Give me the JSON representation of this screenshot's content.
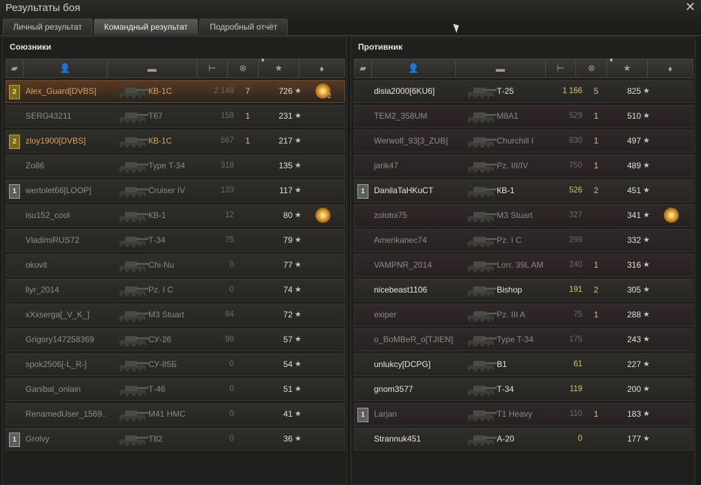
{
  "window": {
    "title": "Результаты боя",
    "close_label": "✕"
  },
  "tabs": [
    {
      "label": "Личный результат",
      "active": false
    },
    {
      "label": "Командный результат",
      "active": true
    },
    {
      "label": "Подробный отчёт",
      "active": false
    }
  ],
  "columns": [
    "squad-icon",
    "player-icon",
    "tank-icon",
    "damage-icon",
    "kills-icon",
    "xp-star-icon",
    "medal-icon"
  ],
  "header_glyphs": {
    "squad": "▰",
    "player": "👤",
    "tank": "▬",
    "damage": "⊢",
    "kills": "⊗",
    "star": "★",
    "medal": "♦"
  },
  "allies": {
    "title": "Союзники",
    "rows": [
      {
        "squad": "2",
        "squad_type": "gold",
        "player": "Alex_Guard[DVBS]",
        "vehicle": "КВ-1С",
        "damage": "2 148",
        "frags": "7",
        "xp": "726",
        "medal": true,
        "medal_count": "2",
        "style": "hl"
      },
      {
        "squad": "",
        "player": "SERG43211",
        "vehicle": "T67",
        "damage": "158",
        "frags": "1",
        "xp": "231",
        "style": "normal"
      },
      {
        "squad": "2",
        "squad_type": "gold",
        "player": "zloy1900[DVBS]",
        "vehicle": "КВ-1С",
        "damage": "567",
        "frags": "1",
        "xp": "217",
        "style": "orange"
      },
      {
        "squad": "",
        "player": "Zo86",
        "vehicle": "Type T-34",
        "damage": "318",
        "frags": "",
        "xp": "135",
        "style": "normal"
      },
      {
        "squad": "1",
        "squad_type": "silver",
        "player": "wertolet66[LOOP]",
        "vehicle": "Cruiser IV",
        "damage": "133",
        "frags": "",
        "xp": "117",
        "style": "normal"
      },
      {
        "squad": "",
        "player": "isu152_cool",
        "vehicle": "КВ-1",
        "damage": "12",
        "frags": "",
        "xp": "80",
        "medal": true,
        "style": "normal"
      },
      {
        "squad": "",
        "player": "VladimiRUS72",
        "vehicle": "Т-34",
        "damage": "75",
        "frags": "",
        "xp": "79",
        "style": "normal"
      },
      {
        "squad": "",
        "player": "okovit",
        "vehicle": "Chi-Nu",
        "damage": "0",
        "frags": "",
        "xp": "77",
        "style": "normal"
      },
      {
        "squad": "",
        "player": "llyr_2014",
        "vehicle": "Pz. I C",
        "damage": "0",
        "frags": "",
        "xp": "74",
        "style": "normal"
      },
      {
        "squad": "",
        "player": "xXxserga[_V_K_]",
        "vehicle": "M3 Stuart",
        "damage": "84",
        "frags": "",
        "xp": "72",
        "style": "normal"
      },
      {
        "squad": "",
        "player": "Grigory147258369",
        "vehicle": "СУ-26",
        "damage": "99",
        "frags": "",
        "xp": "57",
        "style": "normal"
      },
      {
        "squad": "",
        "player": "spok2506[-L_R-]",
        "vehicle": "СУ-85Б",
        "damage": "0",
        "frags": "",
        "xp": "54",
        "style": "normal"
      },
      {
        "squad": "",
        "player": "Ganibal_onlain",
        "vehicle": "Т-46",
        "damage": "0",
        "frags": "",
        "xp": "51",
        "style": "normal"
      },
      {
        "squad": "",
        "player": "RenamedUser_1569..",
        "vehicle": "M41 HMC",
        "damage": "0",
        "frags": "",
        "xp": "41",
        "style": "normal"
      },
      {
        "squad": "1",
        "squad_type": "silver",
        "player": "Grolvy",
        "vehicle": "T82",
        "damage": "0",
        "frags": "",
        "xp": "36",
        "style": "normal"
      }
    ]
  },
  "enemies": {
    "title": "Противник",
    "rows": [
      {
        "squad": "",
        "player": "disia2000[6KU6]",
        "vehicle": "Т-25",
        "damage": "1 166",
        "frags": "5",
        "xp": "825",
        "style": "bright"
      },
      {
        "squad": "",
        "player": "TEM2_358UM",
        "vehicle": "M8A1",
        "damage": "529",
        "frags": "1",
        "xp": "510",
        "style": "red"
      },
      {
        "squad": "",
        "player": "Werwolf_93[3_ZUB]",
        "vehicle": "Churchill I",
        "damage": "830",
        "frags": "1",
        "xp": "497",
        "style": "red"
      },
      {
        "squad": "",
        "player": "jarik47",
        "vehicle": "Pz. III/IV",
        "damage": "750",
        "frags": "1",
        "xp": "489",
        "style": "red"
      },
      {
        "squad": "1",
        "squad_type": "silver",
        "player": "DanilaTaHKuCT",
        "vehicle": "КВ-1",
        "damage": "526",
        "frags": "2",
        "xp": "451",
        "style": "bright"
      },
      {
        "squad": "",
        "player": "zolotoi75",
        "vehicle": "M3 Stuart",
        "damage": "327",
        "frags": "",
        "xp": "341",
        "medal": true,
        "style": "red"
      },
      {
        "squad": "",
        "player": "Amerikanec74",
        "vehicle": "Pz. I C",
        "damage": "299",
        "frags": "",
        "xp": "332",
        "style": "red"
      },
      {
        "squad": "",
        "player": "VAMPNR_2014",
        "vehicle": "Lorr. 39L AM",
        "damage": "240",
        "frags": "1",
        "xp": "316",
        "style": "red"
      },
      {
        "squad": "",
        "player": "nicebeast1106",
        "vehicle": "Bishop",
        "damage": "191",
        "frags": "2",
        "xp": "305",
        "style": "bright"
      },
      {
        "squad": "",
        "player": "exiper",
        "vehicle": "Pz. III A",
        "damage": "75",
        "frags": "1",
        "xp": "288",
        "style": "red"
      },
      {
        "squad": "",
        "player": "o_BoMBeR_o[TJIEN]",
        "vehicle": "Type T-34",
        "damage": "175",
        "frags": "",
        "xp": "243",
        "style": "red"
      },
      {
        "squad": "",
        "player": "unlukcy[DCPG]",
        "vehicle": "B1",
        "damage": "61",
        "frags": "",
        "xp": "227",
        "style": "bright"
      },
      {
        "squad": "",
        "player": "gnom3577",
        "vehicle": "Т-34",
        "damage": "119",
        "frags": "",
        "xp": "200",
        "style": "bright"
      },
      {
        "squad": "1",
        "squad_type": "silver",
        "player": "Larjan",
        "vehicle": "T1 Heavy",
        "damage": "110",
        "frags": "1",
        "xp": "183",
        "style": "red"
      },
      {
        "squad": "",
        "player": "Strannuk451",
        "vehicle": "A-20",
        "damage": "0",
        "frags": "",
        "xp": "177",
        "style": "bright"
      }
    ]
  },
  "star_glyph": "★"
}
